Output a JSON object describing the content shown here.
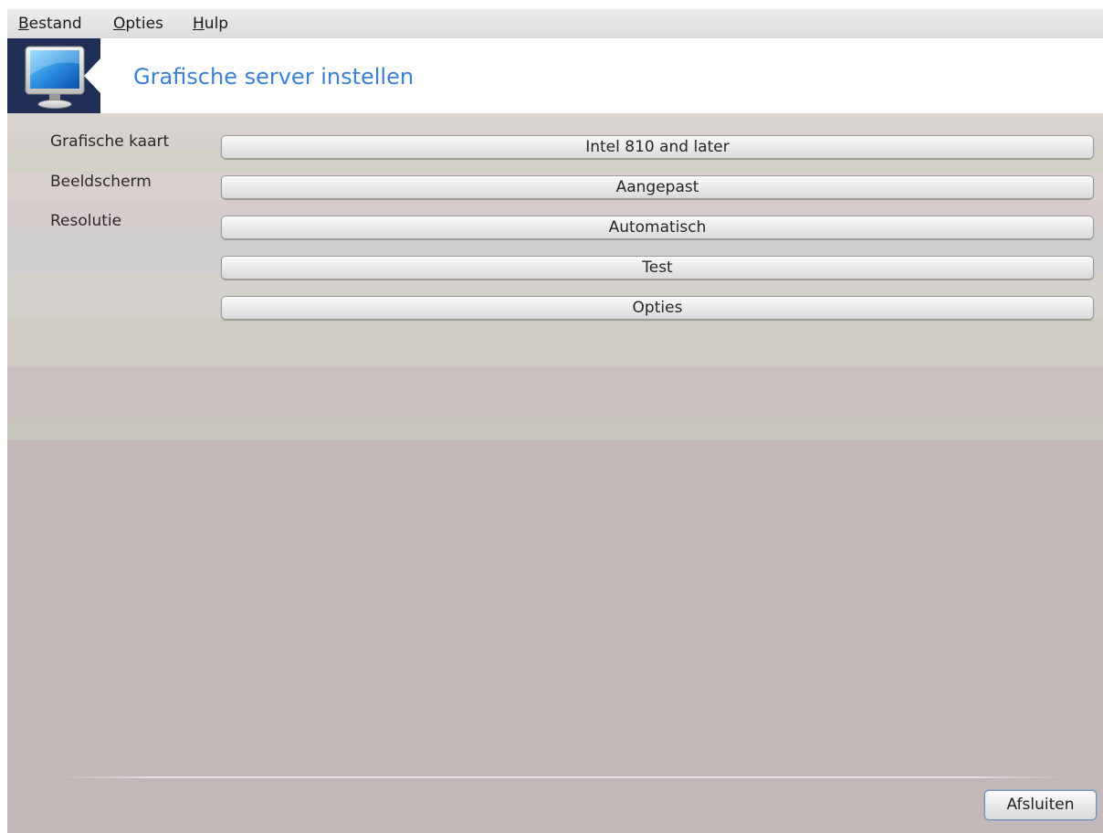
{
  "menubar": {
    "items": [
      {
        "mnemonic": "B",
        "rest": "estand"
      },
      {
        "mnemonic": "O",
        "rest": "pties"
      },
      {
        "mnemonic": "H",
        "rest": "ulp"
      }
    ]
  },
  "header": {
    "title": "Grafische server instellen",
    "icon": "monitor-icon"
  },
  "form": {
    "labels": {
      "graphics_card": "Grafische kaart",
      "monitor": "Beeldscherm",
      "resolution": "Resolutie"
    },
    "buttons": {
      "graphics_card": "Intel 810 and later",
      "monitor": "Aangepast",
      "resolution": "Automatisch",
      "test": "Test",
      "options": "Opties"
    }
  },
  "footer": {
    "quit_label": "Afsluiten"
  },
  "colors": {
    "title_blue": "#3a7fd4",
    "icon_panel": "#1f2f55",
    "window_bg": "#c3b8b7"
  }
}
